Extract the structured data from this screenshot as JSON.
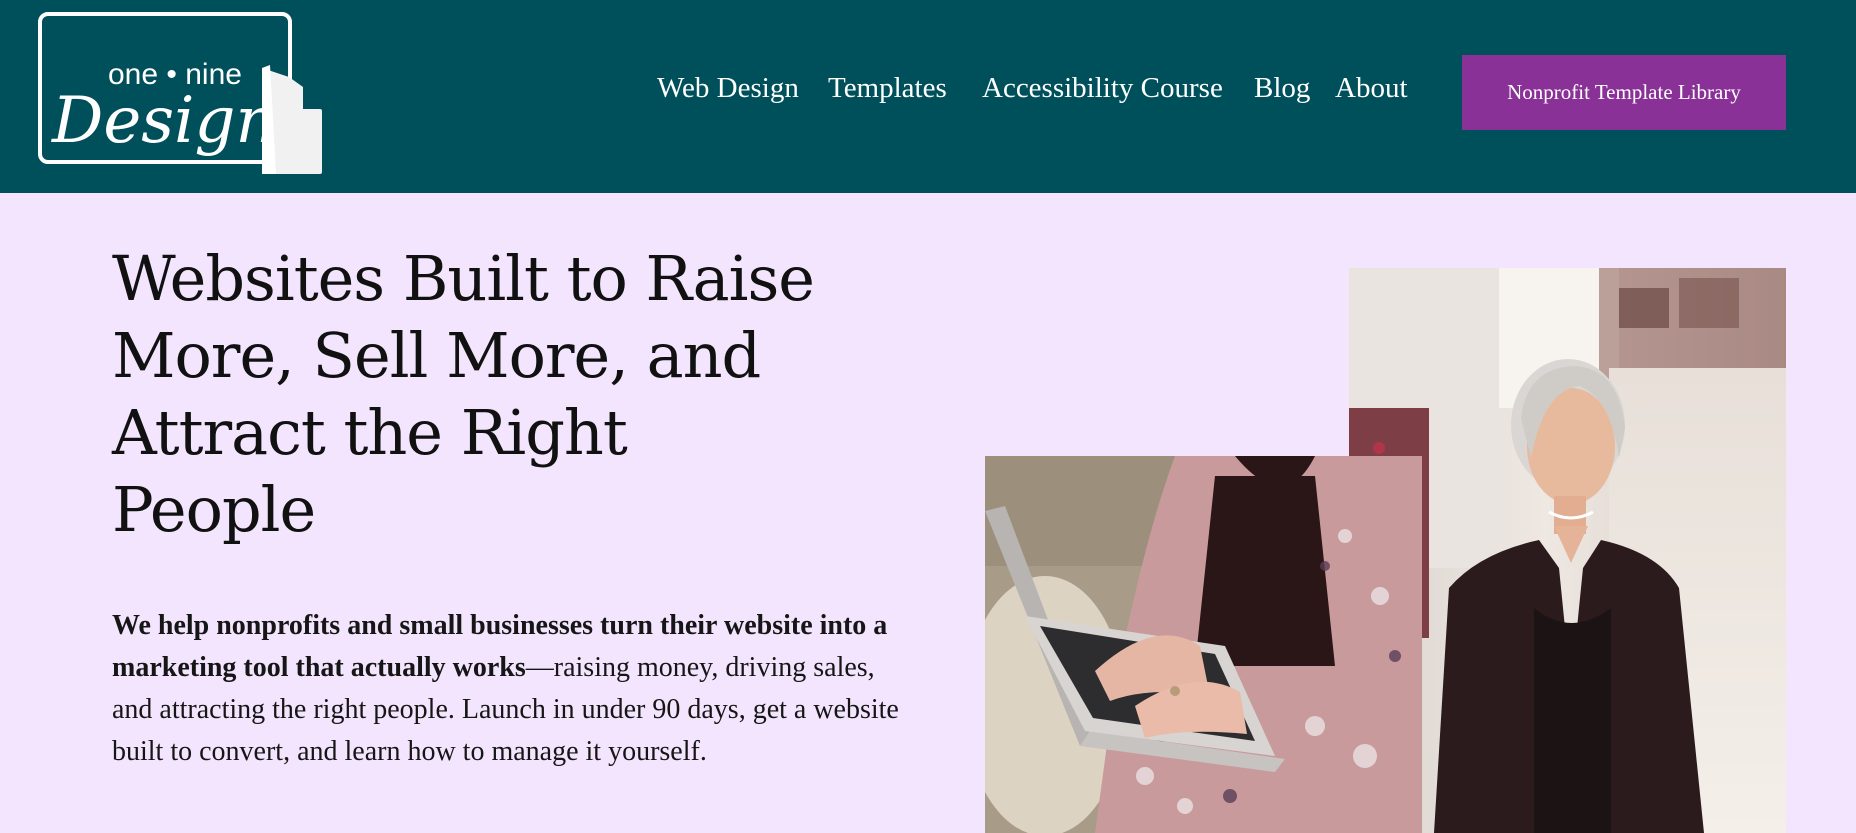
{
  "header": {
    "logo": {
      "line1": "one • nine",
      "line2": "Design"
    },
    "nav": [
      {
        "label": "Web Design"
      },
      {
        "label": "Templates"
      },
      {
        "label": "Accessibility Course"
      },
      {
        "label": "Blog"
      },
      {
        "label": "About"
      }
    ],
    "cta_label": "Nonprofit Template Library"
  },
  "hero": {
    "title": "Websites Built to Raise More, Sell More, and Attract the Right People",
    "body_bold": "We help nonprofits and small businesses turn their website into a marketing tool that actually works",
    "body_rest": "—raising money, driving sales, and attracting the right people. Launch in under 90 days, get a website built to convert, and learn how to manage it yourself."
  },
  "colors": {
    "header_bg": "#00505c",
    "page_bg": "#f3e5fd",
    "cta_bg": "#893197",
    "text": "#111111"
  }
}
